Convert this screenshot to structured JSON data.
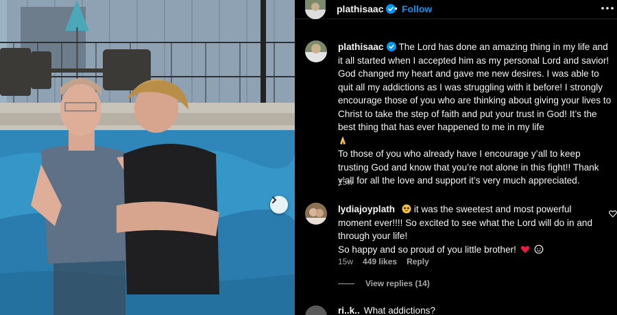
{
  "header": {
    "username": "plathisaac",
    "separator": "•",
    "follow_label": "Follow",
    "more_icon": "more-options-icon"
  },
  "caption": {
    "username": "plathisaac",
    "paragraph1": "The Lord has done an amazing thing in my life and it all started when I accepted him as my personal Lord and savior! God changed my heart and gave me new desires. I was able to quit all my addictions as I was struggling with it before! I strongly encourage those of you who are thinking about giving your lives to Christ to take the step of faith and put your trust in God! It’s the best thing that has ever happened to me in my life",
    "paragraph1_emoji": "praying-hands",
    "paragraph2": "To those of you who already have I encourage y’all to keep trusting God and know that you’re not alone in this fight!! Thank y’all for all the love and support it’s very much appreciated.",
    "time": "15w"
  },
  "comment": {
    "username": "lydiajoyplath",
    "lead_emoji": "pleading-face",
    "text1": "it was the sweetest and most powerful moment ever!!!! So excited to see what the Lord will do in and through your life!",
    "text2": "So happy and so proud of you little brother!",
    "trail_emoji_1": "red-heart",
    "trail_emoji_2": "smiling-face",
    "time": "15w",
    "likes": "449 likes",
    "reply_label": "Reply",
    "view_replies": "View replies (14)"
  },
  "next_comment": {
    "username_partial": "ri..k..",
    "text_partial": "What addictions?"
  },
  "colors": {
    "background": "#000000",
    "text": "#f5f5f5",
    "secondary": "#a8a8a8",
    "link_blue": "#0095f6",
    "verified_blue": "#0095f6"
  }
}
